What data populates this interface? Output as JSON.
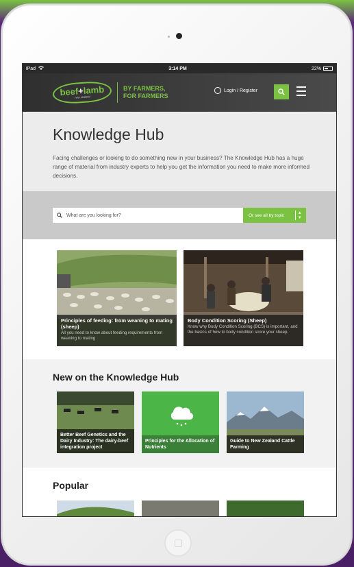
{
  "status": {
    "device": "iPad",
    "time": "3:14 PM",
    "battery": "22%"
  },
  "header": {
    "logo_main_a": "beef",
    "logo_main_b": "+",
    "logo_main_c": "lamb",
    "logo_sub": "new zealand",
    "tagline_1": "BY FARMERS,",
    "tagline_2": "FOR FARMERS",
    "login": "Login / Register"
  },
  "hero": {
    "title": "Knowledge Hub",
    "description": "Facing challenges or looking to do something new in your business? The Knowledge Hub has a huge range of material from industry experts to help you get the information you need to make more informed decisions."
  },
  "search": {
    "placeholder": "What are you looking for?",
    "topic_button": "Or see all by topic"
  },
  "featured": [
    {
      "title": "Principles of feeding: from weaning to mating (sheep)",
      "desc": "All you need to know about feeding requirements from weaning to mating"
    },
    {
      "title": "Body Condition Scoring (Sheep)",
      "desc": "Know why Body Condition Scoring (BCS) is important, and the basics of how to body condition score your sheep."
    }
  ],
  "new_section": {
    "title": "New on the Knowledge Hub",
    "items": [
      {
        "title": "Better Beef Genetics and the Dairy Industry: The dairy-beef integration project"
      },
      {
        "title": "Principles for the Allocation of Nutrients"
      },
      {
        "title": "Guide to New Zealand Cattle Farming"
      }
    ]
  },
  "popular": {
    "title": "Popular"
  },
  "colors": {
    "accent": "#7bc142",
    "header": "#3a3a3a"
  }
}
